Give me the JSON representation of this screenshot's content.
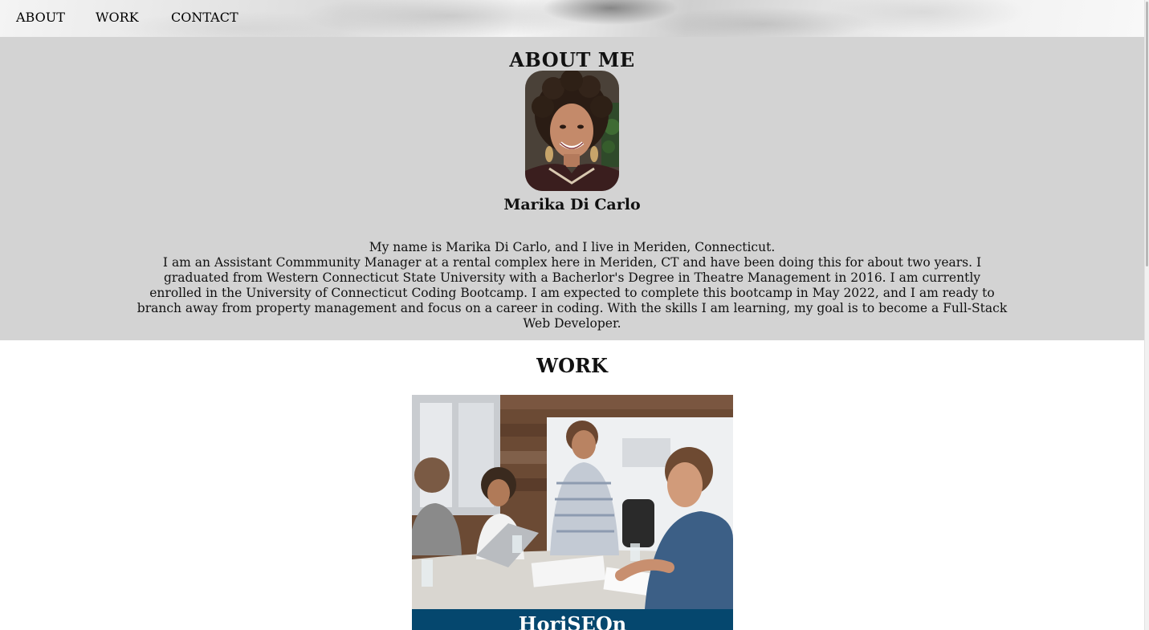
{
  "nav": {
    "items": [
      "ABOUT",
      "WORK",
      "CONTACT"
    ]
  },
  "about": {
    "title": "ABOUT ME",
    "name": "Marika Di Carlo",
    "bio_line1": "My name is Marika Di Carlo, and I live in Meriden, Connecticut.",
    "bio_line2": "I am an Assistant Commmunity Manager at a rental complex here in Meriden, CT and have been doing this for about two years. I graduated from Western Connecticut State University with a Bacherlor's Degree in Theatre Management in 2016. I am currently enrolled in the University of Connecticut Coding Bootcamp. I am expected to complete this bootcamp in May 2022, and I am ready to branch away from property management and focus on a career in coding. With the skills I am learning, my goal is to become a Full-Stack Web Developer."
  },
  "work": {
    "title": "WORK",
    "projects": [
      {
        "title": "HoriSEOn"
      }
    ]
  },
  "colors": {
    "about_bg": "#d3d3d3",
    "caption_bg": "#05476e"
  }
}
